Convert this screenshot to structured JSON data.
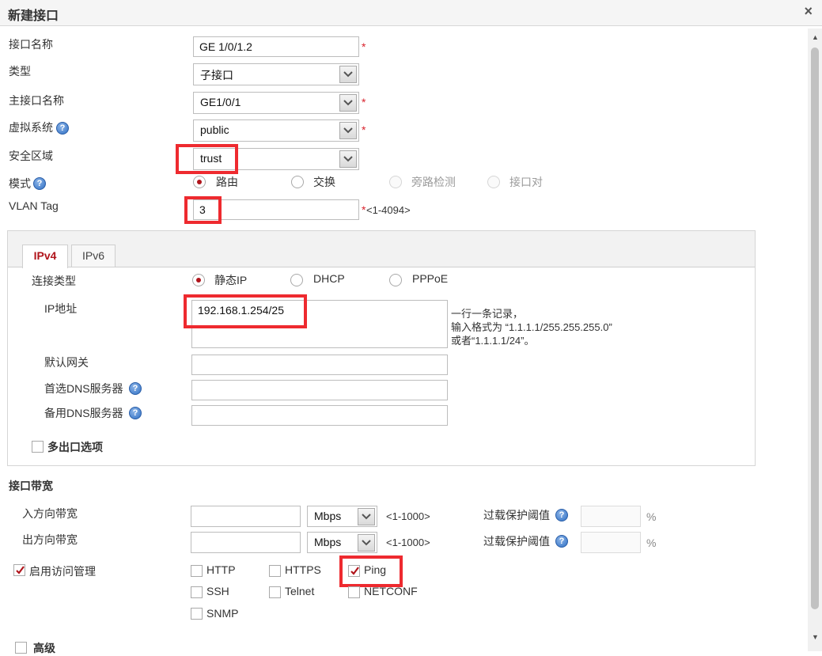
{
  "dialog": {
    "title": "新建接口",
    "close_symbol": "×"
  },
  "form": {
    "name_label": "接口名称",
    "name_value": "GE 1/0/1.2",
    "type_label": "类型",
    "type_value": "子接口",
    "main_if_label": "主接口名称",
    "main_if_value": "GE1/0/1",
    "vsys_label": "虚拟系统",
    "vsys_value": "public",
    "zone_label": "安全区域",
    "zone_value": "trust",
    "mode_label": "模式",
    "mode_options": [
      "路由",
      "交换",
      "旁路检测",
      "接口对"
    ],
    "vlan_label": "VLAN Tag",
    "vlan_value": "3",
    "vlan_range": "<1-4094>",
    "required_mark": "*",
    "help_symbol": "?"
  },
  "ipv4_panel": {
    "tabs": [
      "IPv4",
      "IPv6"
    ],
    "conn_type_label": "连接类型",
    "conn_options": [
      "静态IP",
      "DHCP",
      "PPPoE"
    ],
    "ip_label": "IP地址",
    "ip_value": "192.168.1.254/25",
    "ip_hint": [
      "一行一条记录，",
      "输入格式为 “1.1.1.1/255.255.255.0”",
      "或者“1.1.1.1/24”。"
    ],
    "gateway_label": "默认网关",
    "dns1_label": "首选DNS服务器",
    "dns2_label": "备用DNS服务器",
    "multi_exit_label": "多出口选项"
  },
  "bandwidth": {
    "section_title": "接口带宽",
    "in_label": "入方向带宽",
    "out_label": "出方向带宽",
    "unit_value": "Mbps",
    "range": "<1-1000>",
    "overload_label": "过载保护阈值",
    "percent": "%"
  },
  "access": {
    "enable_label": "启用访问管理",
    "services": [
      "HTTP",
      "HTTPS",
      "Ping",
      "SSH",
      "Telnet",
      "NETCONF",
      "SNMP"
    ],
    "checked": [
      false,
      false,
      true,
      false,
      false,
      false,
      false
    ]
  },
  "advanced_label": "高级",
  "colors": {
    "accent": "#b0141b",
    "highlight_box": "#ee2a2f",
    "required": "#d9232d"
  }
}
